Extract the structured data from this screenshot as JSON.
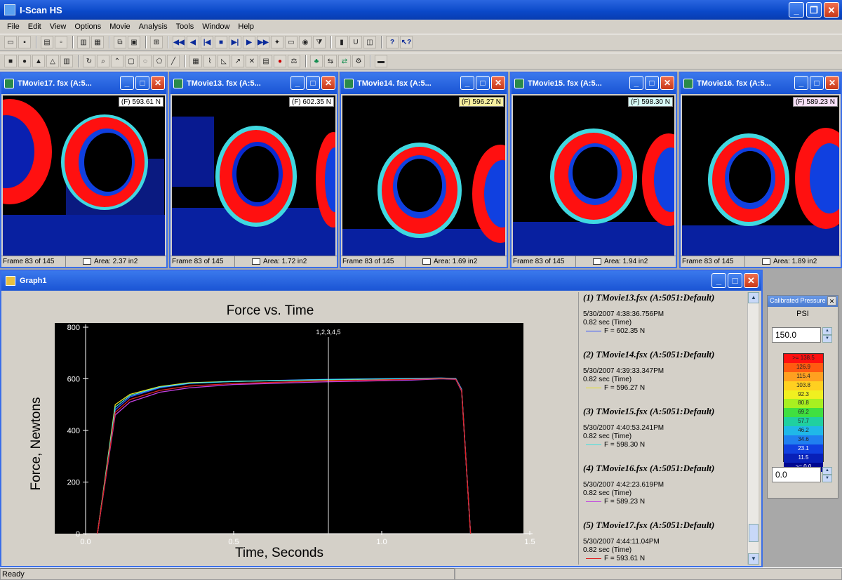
{
  "app": {
    "title": "I-Scan HS"
  },
  "menu": [
    "File",
    "Edit",
    "View",
    "Options",
    "Movie",
    "Analysis",
    "Tools",
    "Window",
    "Help"
  ],
  "movies": [
    {
      "title": "TMovie17. fsx (A:5...",
      "force": "(F) 593.61 N",
      "frame": "Frame 83 of 145",
      "area": "Area: 2.37 in2"
    },
    {
      "title": "TMovie13. fsx (A:5...",
      "force": "(F) 602.35 N",
      "frame": "Frame 83 of 145",
      "area": "Area: 1.72 in2"
    },
    {
      "title": "TMovie14. fsx (A:5...",
      "force": "(F) 596.27 N",
      "frame": "Frame 83 of 145",
      "area": "Area: 1.69 in2"
    },
    {
      "title": "TMovie15. fsx (A:5...",
      "force": "(F) 598.30 N",
      "frame": "Frame 83 of 145",
      "area": "Area: 1.94 in2"
    },
    {
      "title": "TMovie16. fsx (A:5...",
      "force": "(F) 589.23 N",
      "frame": "Frame 83 of 145",
      "area": "Area: 1.89 in2"
    }
  ],
  "graph": {
    "window_title": "Graph1",
    "legend": [
      {
        "header": "(1) TMovie13.fsx (A:5051:Default)",
        "timestamp": "5/30/2007 4:38:36.756PM",
        "time": "0.82 sec (Time)",
        "force": "F = 602.35 N",
        "color": "#3050ff"
      },
      {
        "header": "(2) TMovie14.fsx (A:5051:Default)",
        "timestamp": "5/30/2007 4:39:33.347PM",
        "time": "0.82 sec (Time)",
        "force": "F = 596.27 N",
        "color": "#e8e020"
      },
      {
        "header": "(3) TMovie15.fsx (A:5051:Default)",
        "timestamp": "5/30/2007 4:40:53.241PM",
        "time": "0.82 sec (Time)",
        "force": "F = 598.30 N",
        "color": "#40e0e0"
      },
      {
        "header": "(4) TMovie16.fsx (A:5051:Default)",
        "timestamp": "5/30/2007 4:42:23.619PM",
        "time": "0.82 sec (Time)",
        "force": "F = 589.23 N",
        "color": "#c040e0"
      },
      {
        "header": "(5) TMovie17.fsx (A:5051:Default)",
        "timestamp": "5/30/2007 4:44:11.04PM",
        "time": "0.82 sec (Time)",
        "force": "F = 593.61 N",
        "color": "#e02020"
      }
    ]
  },
  "chart_data": {
    "type": "line",
    "title": "Force vs. Time",
    "xlabel": "Time, Seconds",
    "ylabel": "Force, Newtons",
    "xlim": [
      0,
      1.5
    ],
    "ylim": [
      0,
      800
    ],
    "xticks": [
      "0.0",
      "0.5",
      "1.0",
      "1.5"
    ],
    "yticks": [
      "0",
      "200",
      "400",
      "600",
      "800"
    ],
    "cursor": {
      "x": 0.82,
      "label": "1,2,3,4,5"
    },
    "series": [
      {
        "color": "#3050ff",
        "x": [
          0.04,
          0.1,
          0.15,
          0.25,
          0.35,
          0.5,
          0.8,
          1.1,
          1.2,
          1.25,
          1.27,
          1.3
        ],
        "y": [
          0,
          480,
          530,
          565,
          582,
          590,
          598,
          602,
          603,
          602,
          560,
          0
        ]
      },
      {
        "color": "#e8e020",
        "x": [
          0.04,
          0.1,
          0.15,
          0.25,
          0.35,
          0.5,
          0.8,
          1.1,
          1.2,
          1.25,
          1.27,
          1.3
        ],
        "y": [
          0,
          500,
          540,
          570,
          585,
          590,
          596,
          600,
          602,
          600,
          555,
          0
        ]
      },
      {
        "color": "#40e0e0",
        "x": [
          0.04,
          0.1,
          0.15,
          0.25,
          0.35,
          0.5,
          0.8,
          1.1,
          1.2,
          1.25,
          1.27,
          1.3
        ],
        "y": [
          0,
          490,
          535,
          568,
          583,
          590,
          597,
          601,
          603,
          601,
          558,
          0
        ]
      },
      {
        "color": "#c040e0",
        "x": [
          0.04,
          0.1,
          0.15,
          0.25,
          0.35,
          0.5,
          0.8,
          1.1,
          1.2,
          1.25,
          1.27,
          1.3
        ],
        "y": [
          0,
          460,
          510,
          548,
          565,
          578,
          588,
          595,
          600,
          598,
          552,
          0
        ]
      },
      {
        "color": "#e02020",
        "x": [
          0.04,
          0.1,
          0.15,
          0.25,
          0.35,
          0.5,
          0.8,
          1.1,
          1.2,
          1.25,
          1.27,
          1.3
        ],
        "y": [
          0,
          470,
          520,
          555,
          572,
          582,
          592,
          598,
          601,
          599,
          555,
          0
        ]
      }
    ]
  },
  "palette": {
    "title": "Calibrated Pressure",
    "unit": "PSI",
    "max": "150.0",
    "min": "0.0",
    "levels": [
      {
        "label": ">= 138.5",
        "color": "#ff1010"
      },
      {
        "label": "126.9",
        "color": "#ff5a10"
      },
      {
        "label": "115.4",
        "color": "#ffa020"
      },
      {
        "label": "103.8",
        "color": "#ffd020"
      },
      {
        "label": "92.3",
        "color": "#f0f020"
      },
      {
        "label": "80.8",
        "color": "#a8f020"
      },
      {
        "label": "69.2",
        "color": "#40e040"
      },
      {
        "label": "57.7",
        "color": "#20d0a0"
      },
      {
        "label": "46.2",
        "color": "#20b8e8"
      },
      {
        "label": "34.6",
        "color": "#2080f0"
      },
      {
        "label": "23.1",
        "color": "#1040e0"
      },
      {
        "label": "11.5",
        "color": "#0820b8"
      },
      {
        "label": ">= 0.0",
        "color": "#000890"
      }
    ]
  },
  "status": {
    "text": "Ready"
  }
}
